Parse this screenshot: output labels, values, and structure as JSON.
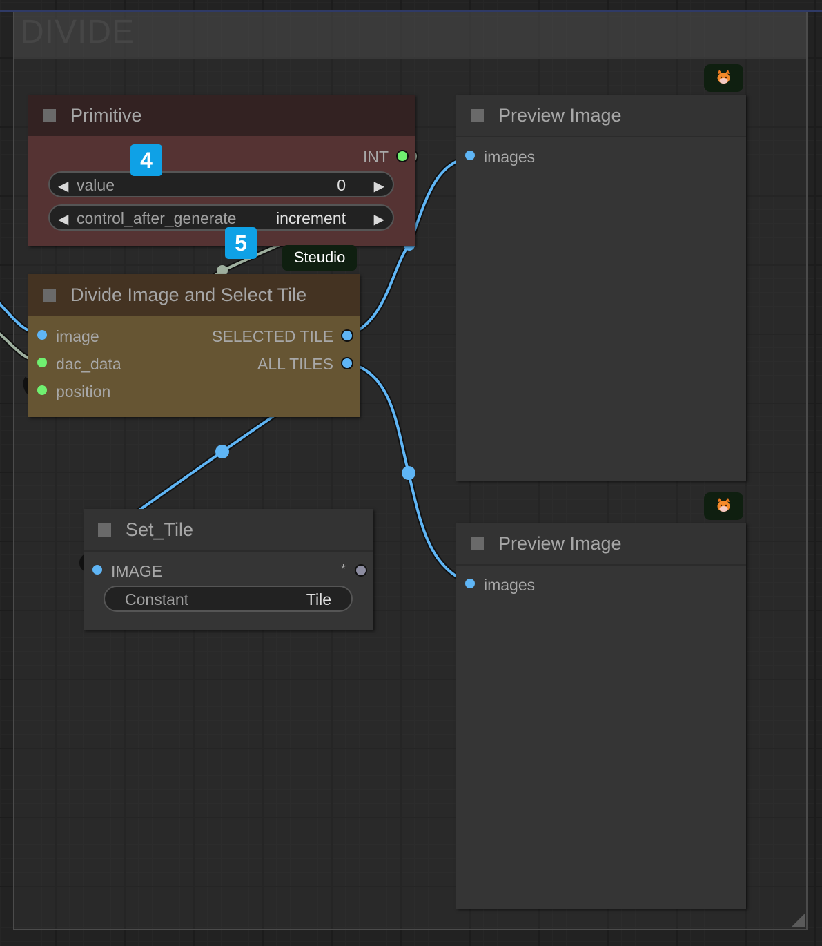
{
  "group": {
    "title": "DIVIDE"
  },
  "colors": {
    "image_link": "#5fb5f5",
    "int_link": "#9fb09f",
    "image_slot": "#5fb5f5",
    "int_slot": "#70f070",
    "any_slot": "#8c8ca0",
    "badge_blue": "#0fa1e6",
    "primitive_header": "#332222",
    "primitive_body": "#553333",
    "divide_header": "#443322",
    "divide_body": "#665533",
    "default_header": "#333333",
    "default_body": "#353535"
  },
  "badges": {
    "primitive_badge": "4",
    "divide_badge": "5",
    "studio_label": "Steudio"
  },
  "nodes": {
    "primitive": {
      "title": "Primitive",
      "output_label": "INT",
      "widgets": [
        {
          "label": "value",
          "value": "0"
        },
        {
          "label": "control_after_generate",
          "value": "increment"
        }
      ]
    },
    "divide": {
      "title": "Divide Image and Select Tile",
      "inputs": [
        "image",
        "dac_data",
        "position"
      ],
      "outputs": [
        "SELECTED TILE",
        "ALL TILES"
      ]
    },
    "set_tile": {
      "title": "Set_Tile",
      "input_label": "IMAGE",
      "output_label": "*",
      "widget": {
        "label": "Constant",
        "value": "Tile"
      }
    },
    "preview_1": {
      "title": "Preview Image",
      "input_label": "images",
      "icon": "fox-icon"
    },
    "preview_2": {
      "title": "Preview Image",
      "input_label": "images",
      "icon": "fox-icon"
    }
  }
}
